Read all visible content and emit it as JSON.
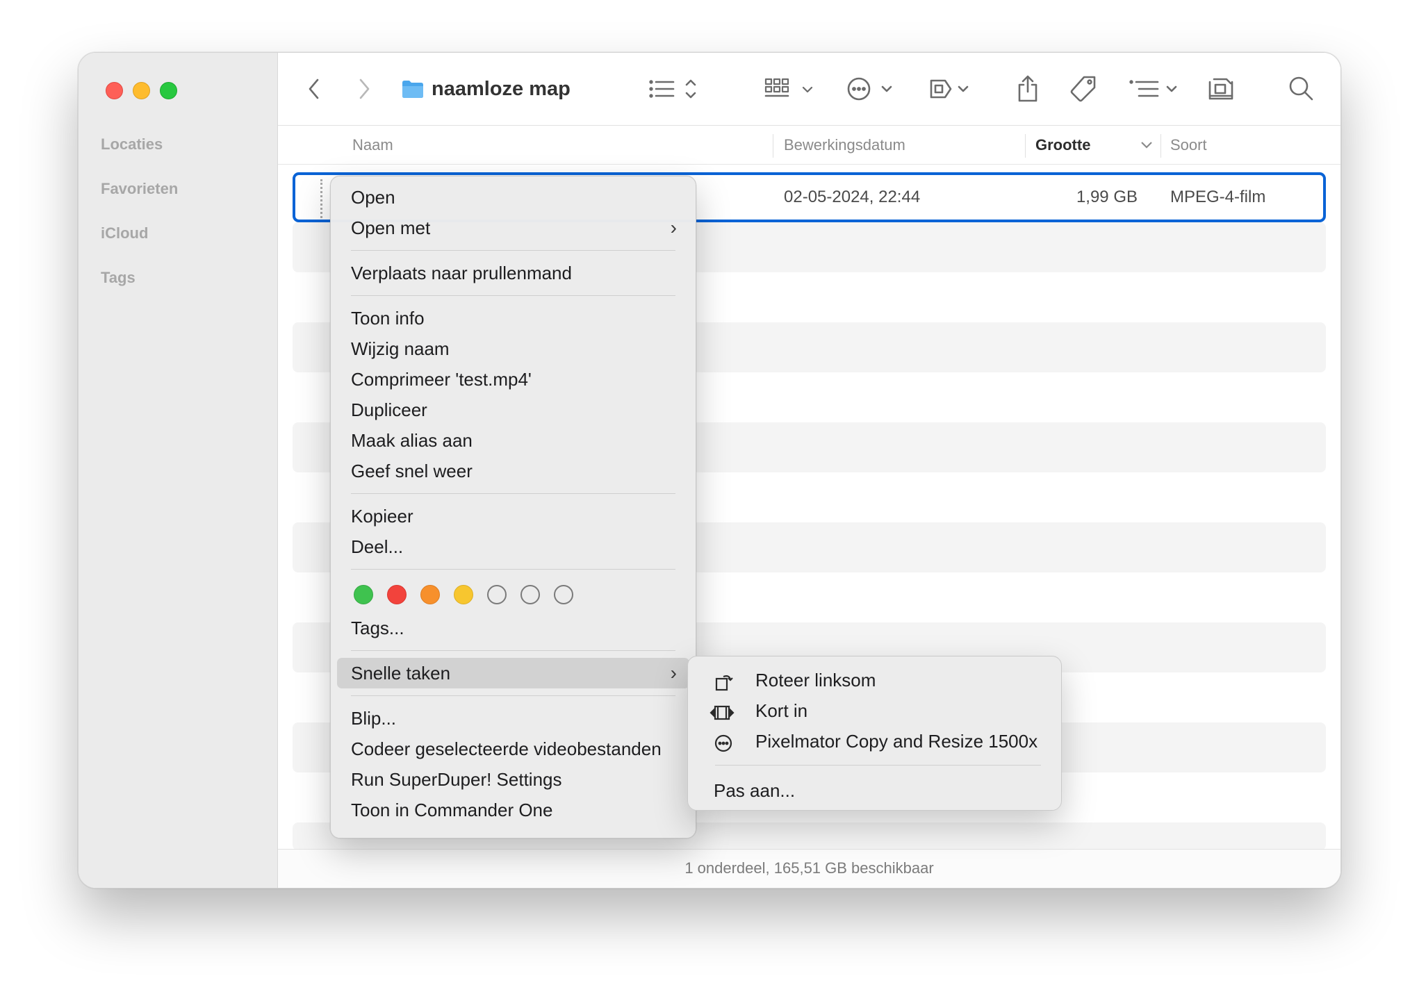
{
  "window": {
    "title": "naamloze map"
  },
  "sidebar": {
    "sections": [
      {
        "label": "Locaties"
      },
      {
        "label": "Favorieten"
      },
      {
        "label": "iCloud"
      },
      {
        "label": "Tags"
      }
    ]
  },
  "toolbar": {
    "icons": [
      "back-icon",
      "forward-icon",
      "folder-icon",
      "list-view-icon",
      "grid-view-icon",
      "more-actions-icon",
      "preview-icon",
      "share-icon",
      "tag-icon",
      "group-icon",
      "airdrop-icon",
      "search-icon"
    ]
  },
  "columns": {
    "name": "Naam",
    "date": "Bewerkingsdatum",
    "size": "Grootte",
    "kind": "Soort"
  },
  "file": {
    "date": "02-05-2024, 22:44",
    "size": "1,99 GB",
    "kind": "MPEG-4-film"
  },
  "status": "1 onderdeel, 165,51 GB beschikbaar",
  "context_menu": {
    "open": "Open",
    "open_with": "Open met",
    "trash": "Verplaats naar prullenmand",
    "info": "Toon info",
    "rename": "Wijzig naam",
    "compress": "Comprimeer 'test.mp4'",
    "duplicate": "Dupliceer",
    "alias": "Maak alias aan",
    "quicklook": "Geef snel weer",
    "copy": "Kopieer",
    "share": "Deel...",
    "tag_colors": [
      "#3fc24f",
      "#f2433c",
      "#f7902c",
      "#f7c62f",
      "none",
      "none",
      "none"
    ],
    "tags": "Tags...",
    "quick_actions": "Snelle taken",
    "blip": "Blip...",
    "encode": "Codeer geselecteerde videobestanden",
    "superduper": "Run SuperDuper! Settings",
    "commander": "Toon in Commander One"
  },
  "submenu": {
    "rotate": "Roteer linksom",
    "trim": "Kort in",
    "pixelmator": "Pixelmator Copy and Resize 1500x",
    "customize": "Pas aan..."
  }
}
